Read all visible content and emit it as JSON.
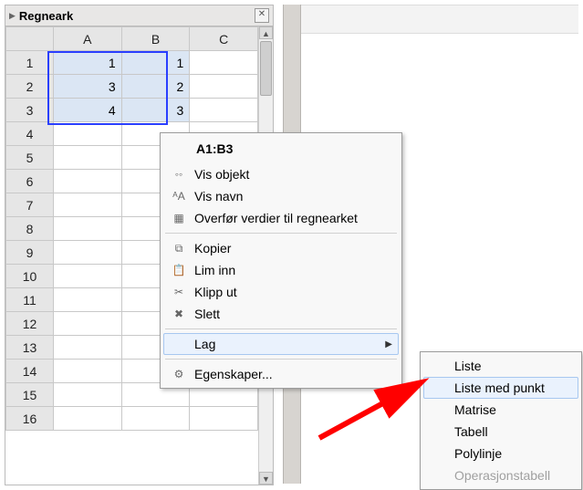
{
  "panel": {
    "title": "Regneark"
  },
  "sheet": {
    "columns": [
      "A",
      "B",
      "C"
    ],
    "rows": [
      1,
      2,
      3,
      4,
      5,
      6,
      7,
      8,
      9,
      10,
      11,
      12,
      13,
      14,
      15,
      16
    ],
    "cells": {
      "r1": {
        "A": "1",
        "B": "1"
      },
      "r2": {
        "A": "3",
        "B": "2"
      },
      "r3": {
        "A": "4",
        "B": "3"
      }
    },
    "selection": "A1:B3"
  },
  "context": {
    "header": "A1:B3",
    "group1": [
      {
        "label": "Vis objekt",
        "icon": "circles-icon"
      },
      {
        "label": "Vis navn",
        "icon": "aa-icon"
      },
      {
        "label": "Overfør verdier til regnearket",
        "icon": "grid-icon"
      }
    ],
    "group2": [
      {
        "label": "Kopier",
        "icon": "copy-icon"
      },
      {
        "label": "Lim inn",
        "icon": "paste-icon"
      },
      {
        "label": "Klipp ut",
        "icon": "cut-icon"
      },
      {
        "label": "Slett",
        "icon": "delete-icon"
      }
    ],
    "group3": [
      {
        "label": "Lag",
        "submenu": true,
        "hover": true
      }
    ],
    "group4": [
      {
        "label": "Egenskaper...",
        "icon": "gear-icon"
      }
    ]
  },
  "submenu": {
    "items": [
      {
        "label": "Liste",
        "enabled": true
      },
      {
        "label": "Liste med punkt",
        "enabled": true,
        "hover": true
      },
      {
        "label": "Matrise",
        "enabled": true
      },
      {
        "label": "Tabell",
        "enabled": true
      },
      {
        "label": "Polylinje",
        "enabled": true
      },
      {
        "label": "Operasjonstabell",
        "enabled": false
      }
    ]
  }
}
